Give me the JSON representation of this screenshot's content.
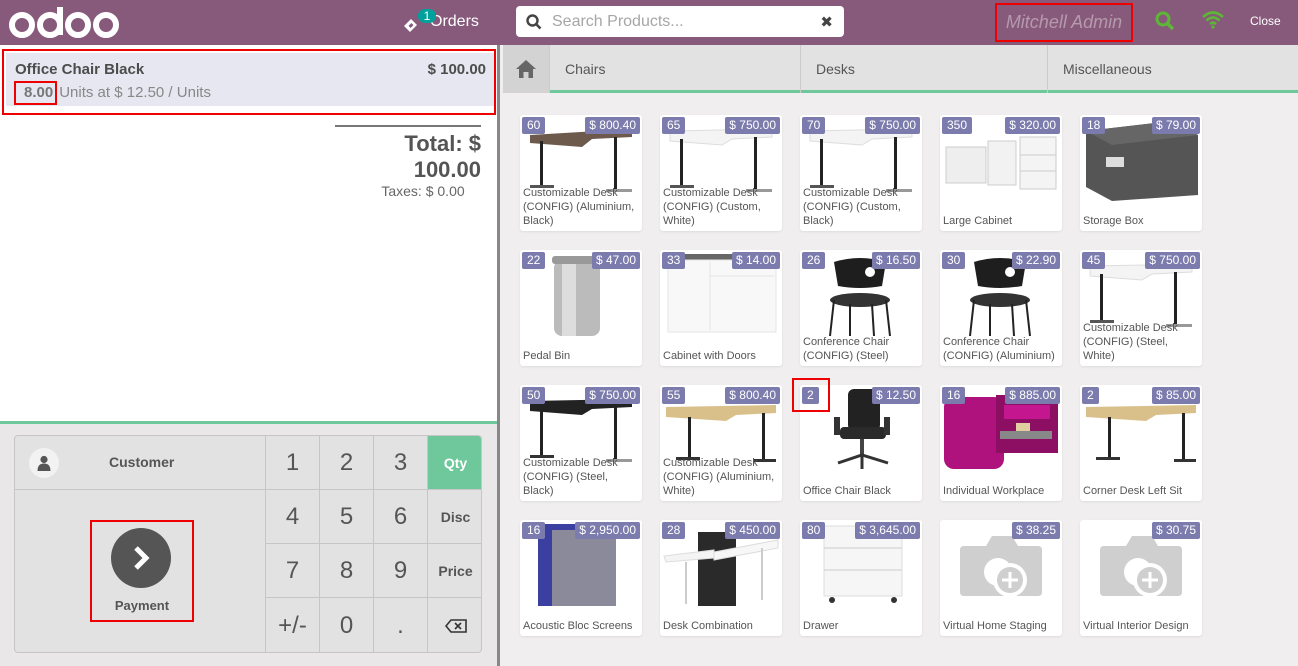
{
  "header": {
    "logo_text": "odoo",
    "orders_label": "Orders",
    "orders_count": "1",
    "search_placeholder": "Search Products...",
    "user_name": "Mitchell Admin",
    "close_label": "Close"
  },
  "order": {
    "lines": [
      {
        "product": "Office Chair Black",
        "price": "$ 100.00",
        "quantity": "8.00",
        "unit_info": "Units at $ 12.50 / Units"
      }
    ],
    "total": "Total: $ 100.00",
    "taxes": "Taxes: $ 0.00"
  },
  "numpad": {
    "customer_label": "Customer",
    "payment_label": "Payment",
    "keys": [
      "1",
      "2",
      "3",
      "Qty",
      "4",
      "5",
      "6",
      "Disc",
      "7",
      "8",
      "9",
      "Price",
      "+/-",
      "0",
      ".",
      "⌫"
    ],
    "active_mode": "Qty"
  },
  "categories": [
    "Chairs",
    "Desks",
    "Miscellaneous"
  ],
  "products": [
    {
      "name": "Customizable Desk (CONFIG) (Aluminium, Black)",
      "stock": "60",
      "price": "$ 800.40",
      "image": "desk-brown"
    },
    {
      "name": "Customizable Desk (CONFIG) (Custom, White)",
      "stock": "65",
      "price": "$ 750.00",
      "image": "desk-white"
    },
    {
      "name": "Customizable Desk (CONFIG) (Custom, Black)",
      "stock": "70",
      "price": "$ 750.00",
      "image": "desk-white"
    },
    {
      "name": "Large Cabinet",
      "stock": "350",
      "price": "$ 320.00",
      "image": "cabinet"
    },
    {
      "name": "Storage Box",
      "stock": "18",
      "price": "$ 79.00",
      "image": "box"
    },
    {
      "name": "Pedal Bin",
      "stock": "22",
      "price": "$ 47.00",
      "image": "bin"
    },
    {
      "name": "Cabinet with Doors",
      "stock": "33",
      "price": "$ 14.00",
      "image": "cabinet-doors"
    },
    {
      "name": "Conference Chair (CONFIG) (Steel)",
      "stock": "26",
      "price": "$ 16.50",
      "image": "chair"
    },
    {
      "name": "Conference Chair (CONFIG) (Aluminium)",
      "stock": "30",
      "price": "$ 22.90",
      "image": "chair"
    },
    {
      "name": "Customizable Desk (CONFIG) (Steel, White)",
      "stock": "45",
      "price": "$ 750.00",
      "image": "desk-white"
    },
    {
      "name": "Customizable Desk (CONFIG) (Steel, Black)",
      "stock": "50",
      "price": "$ 750.00",
      "image": "desk-black"
    },
    {
      "name": "Customizable Desk (CONFIG) (Aluminium, White)",
      "stock": "55",
      "price": "$ 800.40",
      "image": "desk-wood"
    },
    {
      "name": "Office Chair Black",
      "stock": "2",
      "price": "$ 12.50",
      "image": "office-chair"
    },
    {
      "name": "Individual Workplace",
      "stock": "16",
      "price": "$ 885.00",
      "image": "workplace"
    },
    {
      "name": "Corner Desk Left Sit",
      "stock": "2",
      "price": "$ 85.00",
      "image": "desk-wood"
    },
    {
      "name": "Acoustic Bloc Screens",
      "stock": "16",
      "price": "$ 2,950.00",
      "image": "screens"
    },
    {
      "name": "Desk Combination",
      "stock": "28",
      "price": "$ 450.00",
      "image": "desk-combo"
    },
    {
      "name": "Drawer",
      "stock": "80",
      "price": "$ 3,645.00",
      "image": "drawer"
    },
    {
      "name": "Virtual Home Staging",
      "stock": "",
      "price": "$ 38.25",
      "image": "placeholder"
    },
    {
      "name": "Virtual Interior Design",
      "stock": "",
      "price": "$ 30.75",
      "image": "placeholder"
    }
  ],
  "colors": {
    "header": "#875a7b",
    "accent": "#6ec89b",
    "badge": "#7c7bad",
    "orders_badge": "#00a09d",
    "status_green": "#5cb735"
  }
}
